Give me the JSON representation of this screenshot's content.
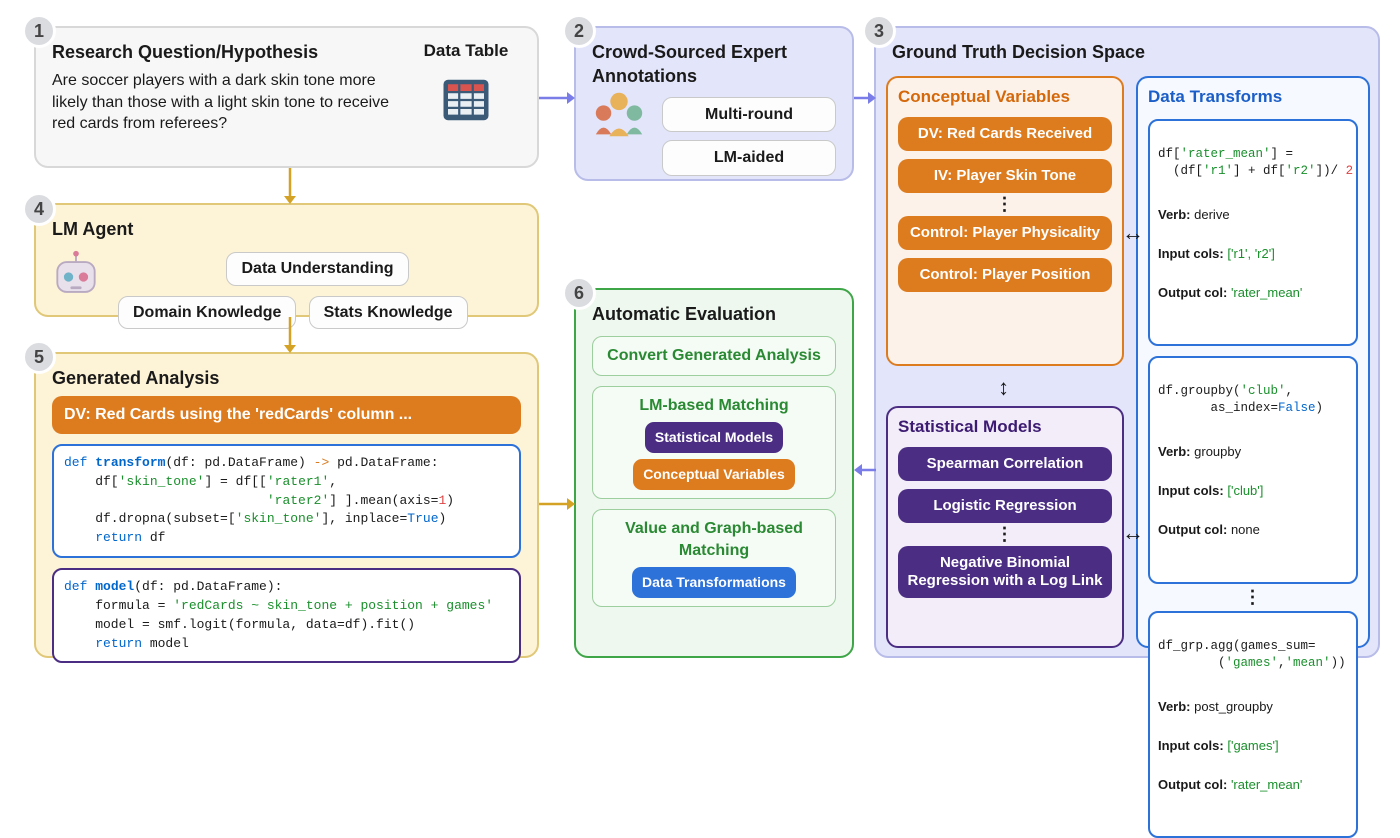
{
  "badges": {
    "b1": "1",
    "b2": "2",
    "b3": "3",
    "b4": "4",
    "b5": "5",
    "b6": "6"
  },
  "p1": {
    "title_left": "Research Question/Hypothesis",
    "title_right": "Data Table",
    "question": "Are soccer players with a dark skin tone more likely than those with a light skin tone to receive red cards from referees?"
  },
  "p2": {
    "title": "Crowd-Sourced Expert Annotations",
    "chip1": "Multi-round",
    "chip2": "LM-aided"
  },
  "p3": {
    "title": "Ground Truth Decision Space",
    "conceptual": {
      "title": "Conceptual Variables",
      "items": [
        "DV: Red Cards Received",
        "IV: Player Skin Tone",
        "Control: Player Physicality",
        "Control: Player Position"
      ]
    },
    "transforms": {
      "title": "Data Transforms",
      "cards": [
        {
          "code": "df['rater_mean'] =\n  (df['r1'] + df['r2'])/ 2",
          "verb": "derive",
          "input": "['r1', 'r2']",
          "output": "'rater_mean'"
        },
        {
          "code": "df.groupby('club',\n       as_index=False)",
          "verb": "groupby",
          "input": "['club']",
          "output": "none"
        },
        {
          "code": "df_grp.agg(games_sum=\n        ('games','mean'))",
          "verb": "post_groupby",
          "input": "['games']",
          "output": "'rater_mean'"
        }
      ]
    },
    "models": {
      "title": "Statistical Models",
      "items": [
        "Spearman Correlation",
        "Logistic Regression",
        "Negative Binomial Regression with a Log Link"
      ]
    }
  },
  "p4": {
    "title": "LM Agent",
    "chips": [
      "Data Understanding",
      "Domain Knowledge",
      "Stats Knowledge"
    ]
  },
  "p5": {
    "title": "Generated Analysis",
    "dv_bar": "DV: Red Cards using the 'redCards' column ...",
    "code_transform": "def transform(df: pd.DataFrame) -> pd.DataFrame:\n    df['skin_tone'] = df[['rater1',\n                          'rater2'] ].mean(axis=1)\n    df.dropna(subset=['skin_tone'], inplace=True)\n    return df",
    "code_model": "def model(df: pd.DataFrame):\n    formula = 'redCards ~ skin_tone + position + games'\n    model = smf.logit(formula, data=df).fit()\n    return model"
  },
  "p6": {
    "title": "Automatic Evaluation",
    "sub1": "Convert Generated Analysis",
    "sub2_title": "LM-based Matching",
    "sub2_pill1": "Statistical Models",
    "sub2_pill2": "Conceptual Variables",
    "sub3_title": "Value and Graph-based Matching",
    "sub3_pill": "Data Transformations"
  },
  "meta_labels": {
    "verb": "Verb:",
    "input": "Input cols:",
    "output": "Output col:"
  },
  "dots": "⋮"
}
